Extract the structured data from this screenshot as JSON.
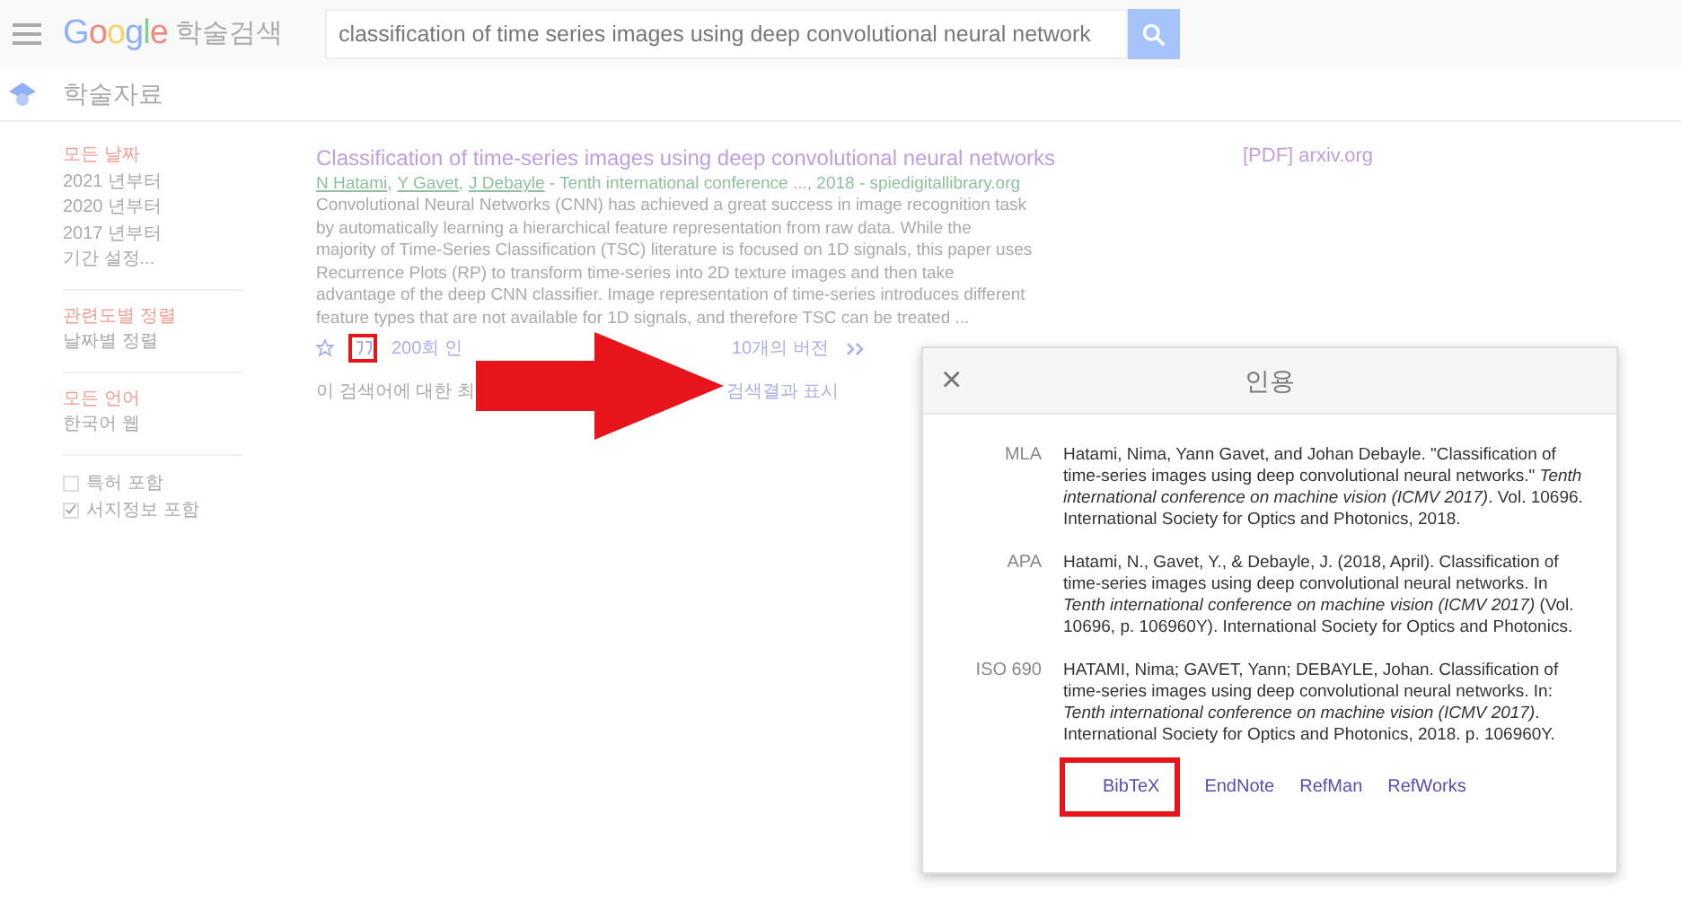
{
  "header": {
    "logo": "Google",
    "product": "학술검색",
    "search_value": "classification of time series images using deep convolutional neural network"
  },
  "subheader": {
    "title": "학술자료"
  },
  "sidebar": {
    "sections": [
      {
        "items": [
          {
            "label": "모든 날짜",
            "selected": true
          },
          {
            "label": "2021 년부터",
            "selected": false
          },
          {
            "label": "2020 년부터",
            "selected": false
          },
          {
            "label": "2017 년부터",
            "selected": false
          },
          {
            "label": "기간 설정...",
            "selected": false
          }
        ]
      },
      {
        "items": [
          {
            "label": "관련도별 정렬",
            "selected": true
          },
          {
            "label": "날짜별 정렬",
            "selected": false
          }
        ]
      },
      {
        "items": [
          {
            "label": "모든 언어",
            "selected": true
          },
          {
            "label": "한국어 웹",
            "selected": false
          }
        ]
      }
    ],
    "checkboxes": [
      {
        "label": "특허 포함",
        "checked": false
      },
      {
        "label": "서지정보 포함",
        "checked": true
      }
    ]
  },
  "result": {
    "title": "Classification of time-series images using deep convolutional neural networks",
    "authors": [
      "N Hatami",
      "Y Gavet",
      "J Debayle"
    ],
    "author_separator": ",",
    "source": " - Tenth international conference ..., 2018 - spiedigitallibrary.org",
    "abstract": "Convolutional Neural Networks (CNN) has achieved a great success in image recognition task by automatically learning a hierarchical feature representation from raw data. While the majority of Time-Series Classification (TSC) literature is focused on 1D signals, this paper uses Recurrence Plots (RP) to transform time-series into 2D texture images and then take advantage of the deep CNN classifier. Image representation of time-series introduces different feature types that are not available for 1D signals, and therefore TSC can be treated ...",
    "cite_annotated": true,
    "cited_by": "200회 인",
    "versions": "10개의 버전",
    "pdf_link": "[PDF] arxiv.org"
  },
  "notice": {
    "before": "이 검색어에 대한 최",
    "after": "검색결과 표시"
  },
  "cite_dialog": {
    "title": "인용",
    "close": "×",
    "citations": [
      {
        "style": "MLA",
        "text": "Hatami, Nima, Yann Gavet, and Johan Debayle. \"Classification of time-series images using deep convolutional neural networks.\" *Tenth international conference on machine vision (ICMV 2017)*. Vol. 10696. International Society for Optics and Photonics, 2018."
      },
      {
        "style": "APA",
        "text": "Hatami, N., Gavet, Y., & Debayle, J. (2018, April). Classification of time-series images using deep convolutional neural networks. In *Tenth international conference on machine vision (ICMV 2017)* (Vol. 10696, p. 106960Y). International Society for Optics and Photonics."
      },
      {
        "style": "ISO 690",
        "text": "HATAMI, Nima; GAVET, Yann; DEBAYLE, Johan. Classification of time-series images using deep convolutional neural networks. In: *Tenth international conference on machine vision (ICMV 2017)*. International Society for Optics and Photonics, 2018. p. 106960Y."
      }
    ],
    "exports": [
      {
        "label": "BibTeX",
        "annotated": true
      },
      {
        "label": "EndNote",
        "annotated": false
      },
      {
        "label": "RefMan",
        "annotated": false
      },
      {
        "label": "RefWorks",
        "annotated": false
      }
    ]
  }
}
